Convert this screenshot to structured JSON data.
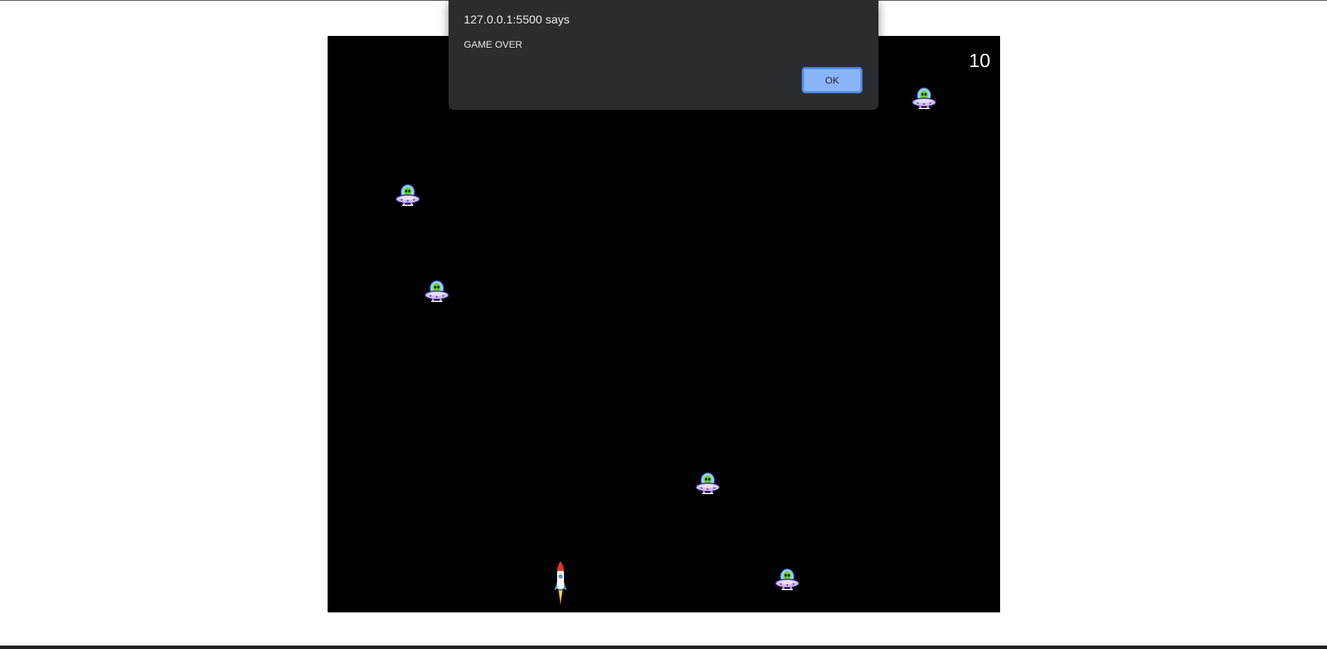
{
  "game": {
    "score": "10",
    "enemies": [
      {
        "name": "alien-ufo-1",
        "icon": "alien-ufo-icon"
      },
      {
        "name": "alien-ufo-2",
        "icon": "alien-ufo-icon"
      },
      {
        "name": "alien-ufo-3",
        "icon": "alien-ufo-icon"
      },
      {
        "name": "alien-ufo-4",
        "icon": "alien-ufo-icon"
      },
      {
        "name": "alien-ufo-5",
        "icon": "alien-ufo-icon"
      }
    ],
    "player": {
      "icon": "rocket-ship-icon"
    },
    "colors": {
      "background": "#000000",
      "score_text": "#ffffff",
      "alien_green": "#6cd02b",
      "saucer_purple": "#b48cd8",
      "rocket_red": "#e0322d"
    }
  },
  "alert": {
    "title": "127.0.0.1:5500 says",
    "message": "GAME OVER",
    "ok_label": "OK",
    "colors": {
      "background": "#2b2c30",
      "button": "#8ab4f8"
    }
  }
}
